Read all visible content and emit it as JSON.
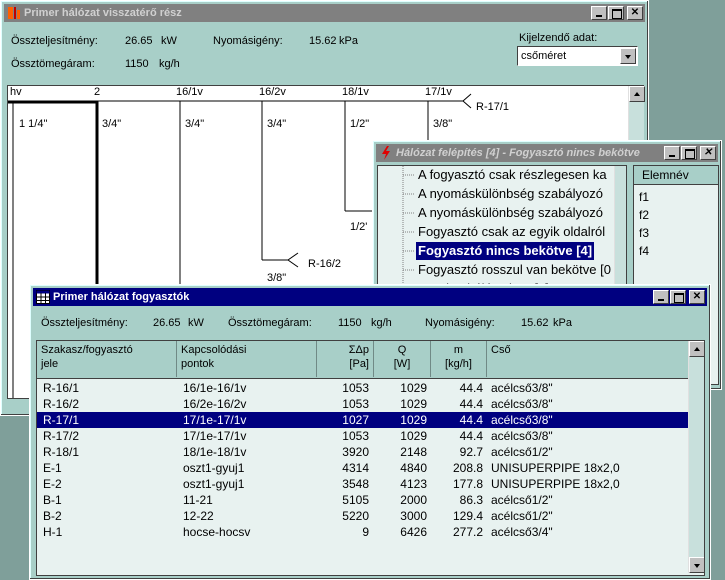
{
  "win_primer": {
    "title": "Primer hálózat visszatérő rész",
    "total_power_label": "Összteljesítmény:",
    "total_power_value": "26.65",
    "total_power_unit": "kW",
    "pressure_label": "Nyomásigény:",
    "pressure_value": "15.62",
    "pressure_unit": "kPa",
    "total_mass_label": "Össztömegáram:",
    "total_mass_value": "1150",
    "total_mass_unit": "kg/h",
    "display_label": "Kijelzendő adat:",
    "display_value": "csőméret",
    "nodes": [
      "hv",
      "2",
      "16/1v",
      "16/2v",
      "18/1v",
      "17/1v"
    ],
    "pipe_sizes": [
      "1 1/4\"",
      "3/4\"",
      "3/4\"",
      "3/4\"",
      "1/2\"",
      "3/8\""
    ],
    "consumer_r171": "R-17/1",
    "consumer_r162": "R-16/2",
    "size_r162": "3/8\"",
    "size_partial": "1/2'"
  },
  "win_felepites": {
    "title": "Hálózat felépítés [4] - Fogyasztó nincs bekötve",
    "items": [
      "A fogyasztó csak részlegesen ka",
      "A nyomáskülönbség szabályozó",
      "A nyomáskülönbség szabályozó",
      "Fogyasztó csak az egyik oldalról",
      "Fogyasztó nincs bekötve [4]",
      "Fogyasztó rosszul van bekötve [0",
      "Hurok a hálózatban [0]"
    ],
    "selected_index": 4,
    "elem_header": "Elemnév",
    "elems": [
      "f1",
      "f2",
      "f3",
      "f4"
    ]
  },
  "win_fogyasztok": {
    "title": "Primer hálózat fogyasztók",
    "total_power_label": "Összteljesítmény:",
    "total_power_value": "26.65",
    "total_power_unit": "kW",
    "total_mass_label": "Össztömegáram:",
    "total_mass_value": "1150",
    "total_mass_unit": "kg/h",
    "pressure_label": "Nyomásigény:",
    "pressure_value": "15.62",
    "pressure_unit": "kPa",
    "headers": {
      "c1a": "Szakasz/fogyasztó",
      "c1b": "jele",
      "c2a": "Kapcsolódási",
      "c2b": "pontok",
      "c3a": "ΣΔp",
      "c3b": "[Pa]",
      "c4a": "Q",
      "c4b": "[W]",
      "c5a": "m",
      "c5b": "[kg/h]",
      "c6a": "Cső"
    },
    "rows": [
      [
        "R-16/1",
        "16/1e-16/1v",
        "1053",
        "1029",
        "44.4",
        "acélcső3/8\""
      ],
      [
        "R-16/2",
        "16/2e-16/2v",
        "1053",
        "1029",
        "44.4",
        "acélcső3/8\""
      ],
      [
        "R-17/1",
        "17/1e-17/1v",
        "1027",
        "1029",
        "44.4",
        "acélcső3/8\""
      ],
      [
        "R-17/2",
        "17/1e-17/1v",
        "1053",
        "1029",
        "44.4",
        "acélcső3/8\""
      ],
      [
        "R-18/1",
        "18/1e-18/1v",
        "3920",
        "2148",
        "92.7",
        "acélcső1/2\""
      ],
      [
        "E-1",
        "oszt1-gyuj1",
        "4314",
        "4840",
        "208.8",
        "UNISUPERPIPE 18x2,0"
      ],
      [
        "E-2",
        "oszt1-gyuj1",
        "3548",
        "4123",
        "177.8",
        "UNISUPERPIPE 18x2,0"
      ],
      [
        "B-1",
        "11-21",
        "5105",
        "2000",
        "86.3",
        "acélcső1/2\""
      ],
      [
        "B-2",
        "12-22",
        "5220",
        "3000",
        "129.4",
        "acélcső1/2\""
      ],
      [
        "H-1",
        "hocse-hocsv",
        "9",
        "6426",
        "277.2",
        "acélcső3/4\""
      ]
    ],
    "selected_row": 2
  },
  "colors": {
    "window_bg": "#a8cfc8",
    "desktop": "#7f9f9a",
    "active_title": "#000080",
    "inactive_title": "#808080"
  }
}
